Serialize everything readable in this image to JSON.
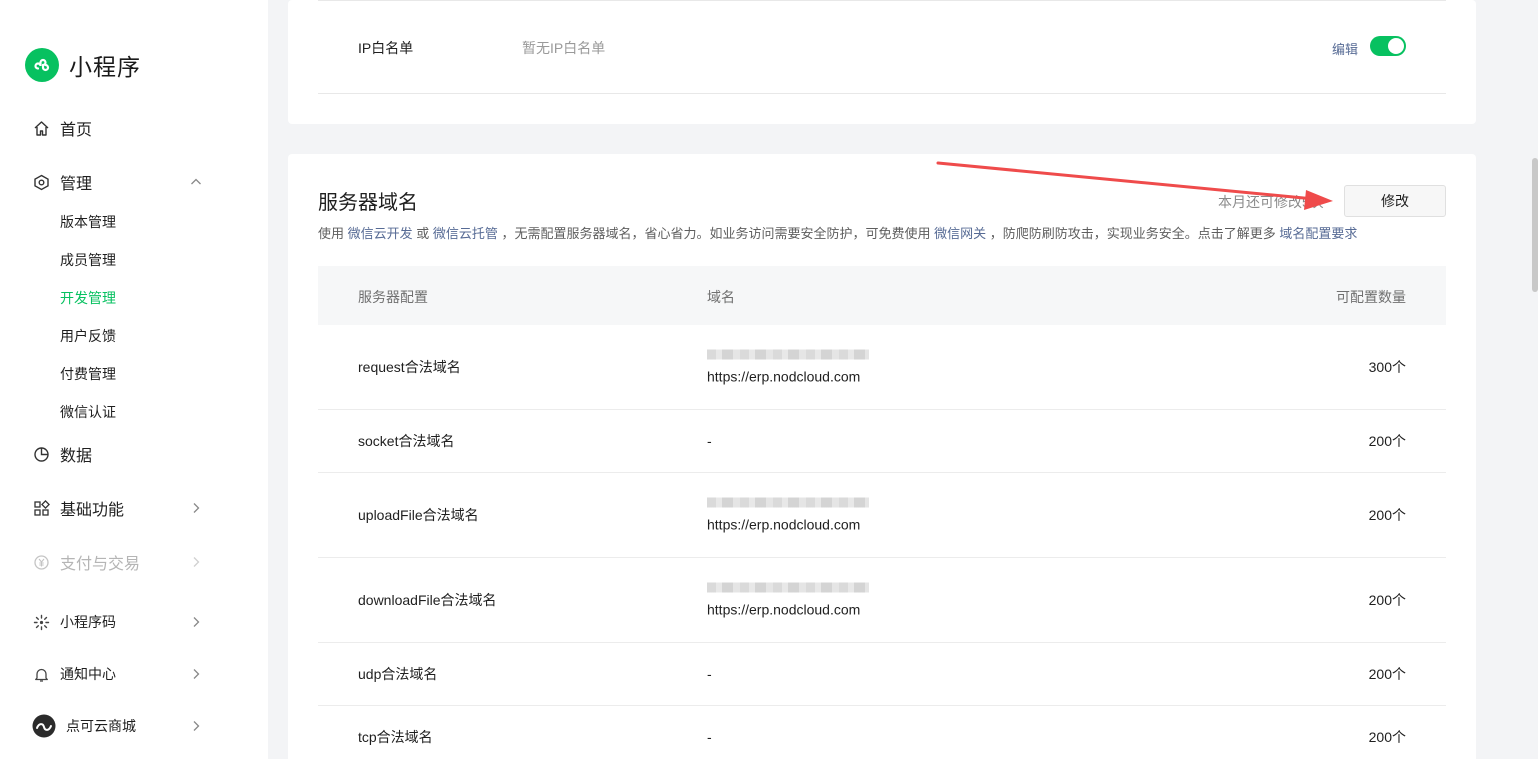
{
  "app": {
    "title": "小程序"
  },
  "sidebar": {
    "home": "首页",
    "manage": "管理",
    "sub_items": [
      "版本管理",
      "成员管理",
      "开发管理",
      "用户反馈",
      "付费管理",
      "微信认证"
    ],
    "active_sub": "开发管理",
    "data": "数据",
    "basic": "基础功能",
    "pay": "支付与交易",
    "qrcode": "小程序码",
    "notify": "通知中心",
    "account": "点可云商城"
  },
  "ip_whitelist": {
    "label": "IP白名单",
    "value": "暂无IP白名单",
    "edit_label": "编辑",
    "enabled": true
  },
  "server_domain": {
    "title": "服务器域名",
    "month_tip": "本月还可修改5次",
    "modify_label": "修改",
    "desc_parts": [
      {
        "text": "使用 ",
        "link": false
      },
      {
        "text": "微信云开发",
        "link": true
      },
      {
        "text": " 或 ",
        "link": false
      },
      {
        "text": "微信云托管",
        "link": true
      },
      {
        "text": " ，无需配置服务器域名，省心省力。如业务访问需要安全防护，可免费使用 ",
        "link": false
      },
      {
        "text": "微信网关",
        "link": true
      },
      {
        "text": " ，防爬防刷防攻击，实现业务安全。点击了解更多 ",
        "link": false
      },
      {
        "text": "域名配置要求",
        "link": true
      }
    ],
    "table": {
      "headers": [
        "服务器配置",
        "域名",
        "可配置数量"
      ],
      "rows": [
        {
          "name": "request合法域名",
          "blurred": true,
          "domain": "https://erp.nodcloud.com",
          "count": "300个"
        },
        {
          "name": "socket合法域名",
          "blurred": false,
          "domain": "-",
          "count": "200个"
        },
        {
          "name": "uploadFile合法域名",
          "blurred": true,
          "domain": "https://erp.nodcloud.com",
          "count": "200个"
        },
        {
          "name": "downloadFile合法域名",
          "blurred": true,
          "domain": "https://erp.nodcloud.com",
          "count": "200个"
        },
        {
          "name": "udp合法域名",
          "blurred": false,
          "domain": "-",
          "count": "200个"
        },
        {
          "name": "tcp合法域名",
          "blurred": false,
          "domain": "-",
          "count": "200个"
        }
      ]
    }
  },
  "colors": {
    "brand": "#07c160",
    "link": "#576b95",
    "annotation_arrow": "#ef4b4b"
  }
}
